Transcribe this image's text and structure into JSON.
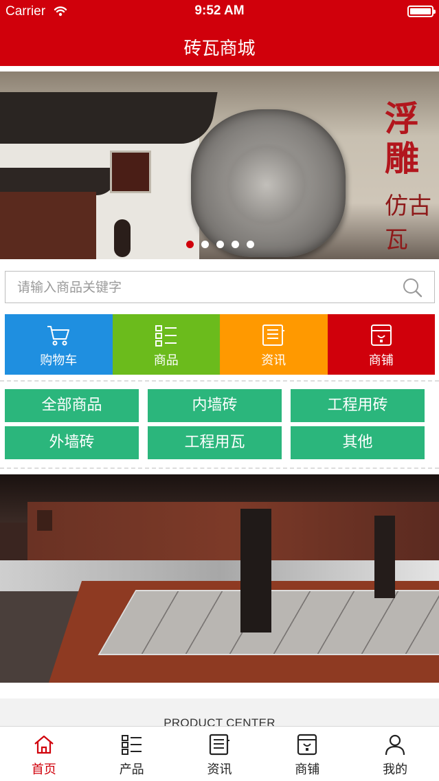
{
  "status_bar": {
    "carrier": "Carrier",
    "time": "9:52 AM",
    "battery_level": 1.0
  },
  "nav": {
    "title": "砖瓦商城"
  },
  "banner": {
    "seal_text": "浮雕",
    "seal_sub": "仿古瓦",
    "slide_count": 5,
    "active_slide": 0
  },
  "search": {
    "placeholder": "请输入商品关键字",
    "value": ""
  },
  "quick_tiles": [
    {
      "label": "购物车",
      "icon": "cart-icon",
      "color": "#1f8fe0"
    },
    {
      "label": "商品",
      "icon": "grid-list-icon",
      "color": "#6bbb1c"
    },
    {
      "label": "资讯",
      "icon": "news-icon",
      "color": "#ff9900"
    },
    {
      "label": "商铺",
      "icon": "shop-icon",
      "color": "#d0000b"
    }
  ],
  "categories": [
    "全部商品",
    "内墙砖",
    "工程用砖",
    "外墙砖",
    "工程用瓦",
    "其他"
  ],
  "product_center": {
    "title": "PRODUCT CENTER"
  },
  "tab_bar": [
    {
      "label": "首页",
      "icon": "home-icon",
      "active": true
    },
    {
      "label": "产品",
      "icon": "grid-list-icon",
      "active": false
    },
    {
      "label": "资讯",
      "icon": "news-icon",
      "active": false
    },
    {
      "label": "商铺",
      "icon": "shop-icon",
      "active": false
    },
    {
      "label": "我的",
      "icon": "person-icon",
      "active": false
    }
  ],
  "colors": {
    "brand_red": "#d0000b",
    "category_green": "#2bb67c"
  }
}
